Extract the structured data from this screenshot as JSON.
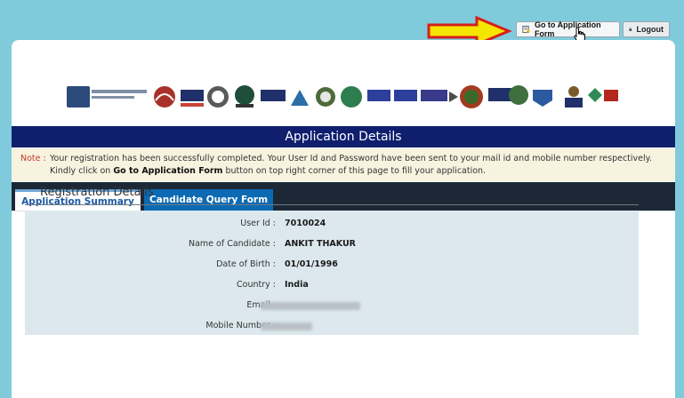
{
  "toolbar": {
    "go_to_application_label": "Go to Application Form",
    "logout_label": "Logout"
  },
  "page": {
    "title": "Application Details"
  },
  "note": {
    "label": "Note :",
    "text_before": "Your registration has been successfully completed. Your User Id and Password have been sent to your mail id and mobile number respectively. Kindly click on ",
    "text_bold": "Go to Application Form",
    "text_after": " button on top right corner of this page to fill your application."
  },
  "tabs": [
    {
      "label": "Application Summary",
      "active": true
    },
    {
      "label": "Candidate Query Form",
      "active": false
    }
  ],
  "registration": {
    "title": "Registration Details",
    "fields": [
      {
        "label": "User Id :",
        "value": "7010024"
      },
      {
        "label": "Name of Candidate :",
        "value": "ANKIT THAKUR"
      },
      {
        "label": "Date of Birth :",
        "value": "01/01/1996"
      },
      {
        "label": "Country :",
        "value": "India"
      },
      {
        "label": "Email :",
        "value": ""
      },
      {
        "label": "Mobile Number :",
        "value": ""
      }
    ]
  },
  "colors": {
    "background": "#7fcbdc",
    "title_bar": "#0f1f6e",
    "tab_bar": "#1c2836",
    "tab_active_text": "#1d5aa6",
    "tab_inactive_bg": "#0c6ab2",
    "arrow": "#f5e600",
    "arrow_outline": "#d81e1e"
  },
  "icons": {
    "go_to_application": "form-icon",
    "logout": "lock-icon",
    "cursor": "hand-cursor-icon",
    "arrow": "arrow-right-icon"
  }
}
